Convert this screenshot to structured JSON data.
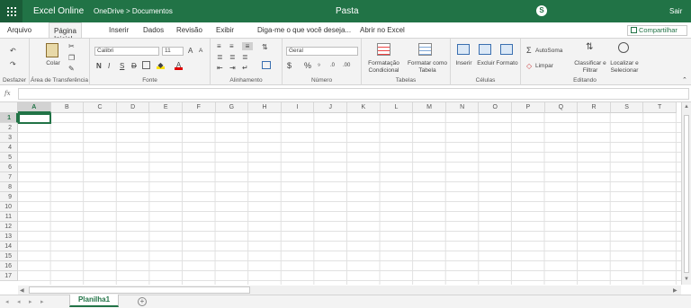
{
  "app": {
    "name": "Excel Online",
    "breadcrumb": "OneDrive > Documentos",
    "document_title": "Pasta",
    "signout": "Sair",
    "share": "Compartilhar"
  },
  "tabs": [
    "Arquivo",
    "Página Inicial",
    "Inserir",
    "Dados",
    "Revisão",
    "Exibir",
    "Diga-me o que você deseja...",
    "Abrir no Excel"
  ],
  "ribbon": {
    "undo": {
      "label": "Desfazer"
    },
    "clipboard": {
      "label": "Área de Transferência",
      "paste": "Colar"
    },
    "font": {
      "label": "Fonte",
      "family": "Calibri",
      "size": "11",
      "bold": "N",
      "italic": "I",
      "underline": "S",
      "strike": "D"
    },
    "alignment": {
      "label": "Alinhamento"
    },
    "number": {
      "label": "Número",
      "format": "Geral",
      "currency": "$",
      "percent": "%"
    },
    "tables": {
      "label": "Tabelas",
      "conditional": "Formatação Condicional",
      "format_table": "Formatar como Tabela"
    },
    "cells": {
      "label": "Células",
      "insert": "Inserir",
      "delete": "Excluir",
      "format": "Formato"
    },
    "editing": {
      "label": "Editando",
      "autosum": "AutoSoma",
      "clear": "Limpar",
      "sort": "Classificar e Filtrar",
      "find": "Localizar e Selecionar"
    }
  },
  "formula_bar": {
    "fx": "fx",
    "value": ""
  },
  "grid": {
    "columns": [
      "A",
      "B",
      "C",
      "D",
      "E",
      "F",
      "G",
      "H",
      "I",
      "J",
      "K",
      "L",
      "M",
      "N",
      "O",
      "P",
      "Q",
      "R",
      "S",
      "T"
    ],
    "rows": [
      "1",
      "2",
      "3",
      "4",
      "5",
      "6",
      "7",
      "8",
      "9",
      "10",
      "11",
      "12",
      "13",
      "14",
      "15",
      "16",
      "17"
    ],
    "active_cell": "A1"
  },
  "sheets": {
    "tabs": [
      "Planilha1"
    ],
    "add": "+"
  },
  "colors": {
    "brand": "#217346",
    "ribbon": "#f3f3f3",
    "gridline": "#e1e1e1"
  }
}
